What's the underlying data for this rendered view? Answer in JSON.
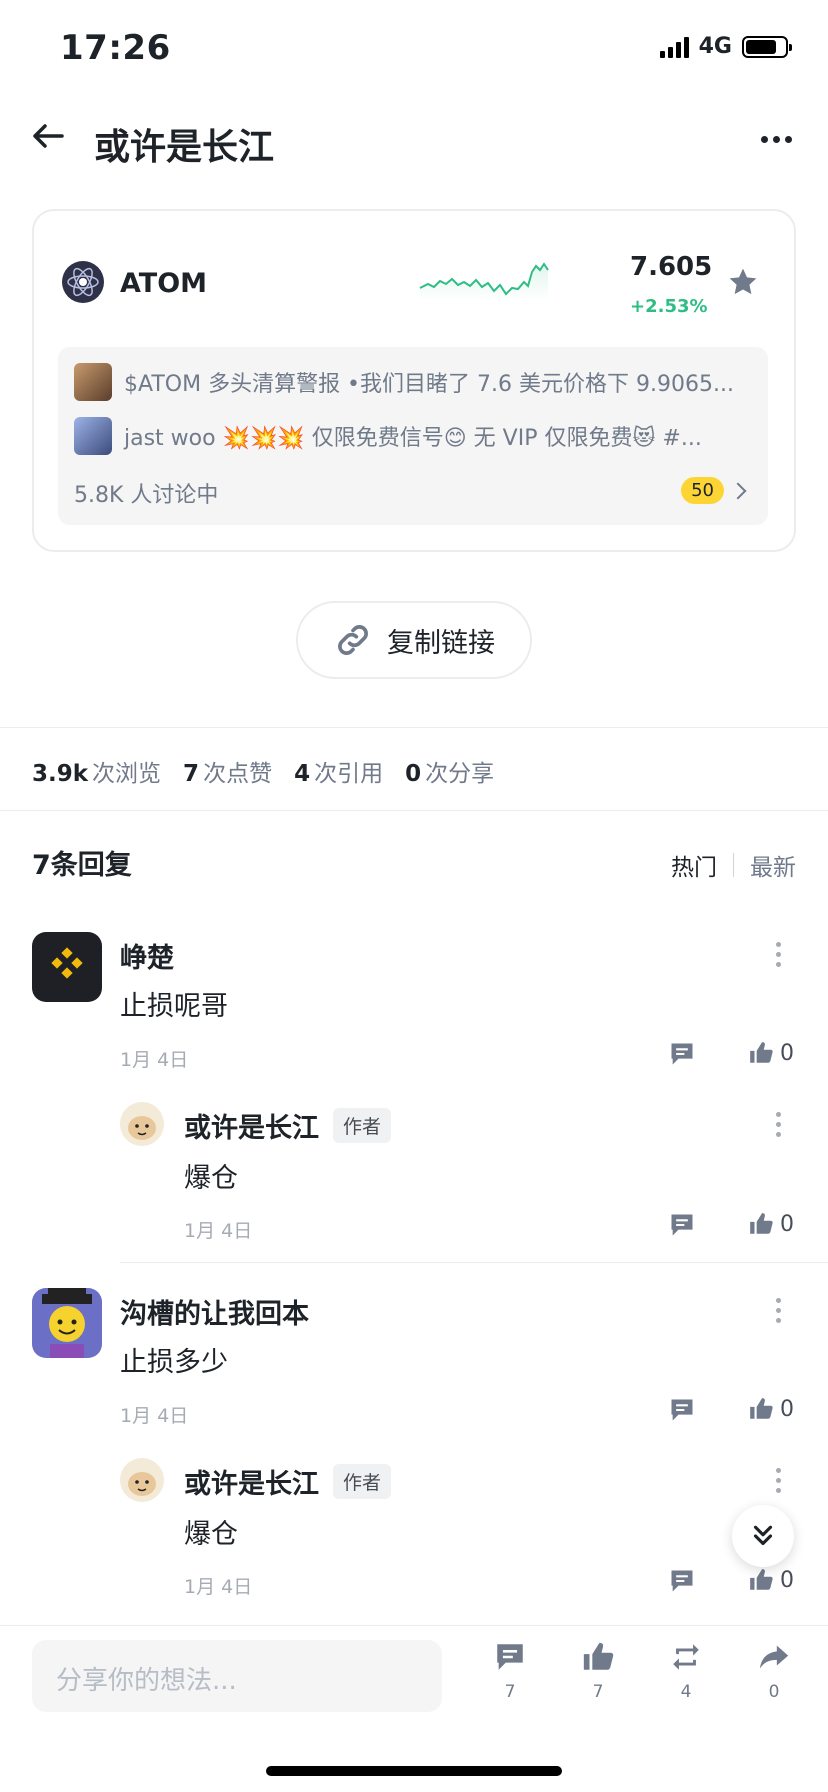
{
  "status": {
    "time": "17:26",
    "network": "4G"
  },
  "header": {
    "title": "或许是长江"
  },
  "coin": {
    "name": "ATOM",
    "price": "7.605",
    "change": "+2.53%",
    "posts": [
      {
        "text": "$ATOM 多头清算警报 •我们目睹了 7.6 美元价格下 9.9065..."
      },
      {
        "text": "jast woo 💥💥💥 仅限免费信号😊 无 VIP 仅限免费😻 #..."
      }
    ],
    "discussing": "5.8K 人讨论中",
    "badge": "50"
  },
  "copy_link": "复制链接",
  "stats": [
    {
      "num": "3.9k",
      "label": "次浏览"
    },
    {
      "num": "7",
      "label": "次点赞"
    },
    {
      "num": "4",
      "label": "次引用"
    },
    {
      "num": "0",
      "label": "次分享"
    }
  ],
  "replies": {
    "title": "7条回复",
    "sort_hot": "热门",
    "sort_new": "最新"
  },
  "comments": [
    {
      "name": "峥楚",
      "text": "止损呢哥",
      "date": "1月 4日",
      "likes": "0"
    },
    {
      "name": "或许是长江",
      "tag": "作者",
      "text": "爆仓",
      "date": "1月 4日",
      "likes": "0"
    },
    {
      "name": "沟槽的让我回本",
      "text": "止损多少",
      "date": "1月 4日",
      "likes": "0"
    },
    {
      "name": "或许是长江",
      "tag": "作者",
      "text": "爆仓",
      "date": "1月 4日",
      "likes": "0"
    }
  ],
  "bottom": {
    "placeholder": "分享你的想法...",
    "comment_count": "7",
    "like_count": "7",
    "repost_count": "4",
    "share_count": "0"
  },
  "colors": {
    "accent": "#fcd535",
    "up": "#2ebd85",
    "text": "#1e2329",
    "muted": "#707a8a"
  }
}
